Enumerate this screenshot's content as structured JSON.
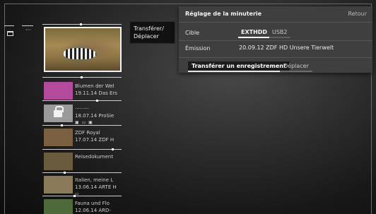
{
  "left_column": {
    "more_label": "···"
  },
  "recordings": {
    "items": [
      {
        "title": "Blumen der Wel",
        "date_channel": "19.11.14 Das Ers",
        "badges": "",
        "thumb_color": "#b44a9c",
        "locked": false
      },
      {
        "title": "·········",
        "date_channel": "18.07.14 ProSie",
        "badges": "▣ ▭ ▣",
        "thumb_color": "#9a9a9a",
        "locked": true
      },
      {
        "title": "ZDF Royal",
        "date_channel": "17.07.14 ZDF H",
        "badges": "",
        "thumb_color": "#7a6040",
        "locked": false
      },
      {
        "title": "Reisedokument",
        "date_channel": "",
        "badges": "",
        "thumb_color": "#6a5a3e",
        "locked": false
      },
      {
        "title": "Italien, meine L",
        "date_channel": "13.06.14 ARTE H",
        "badges": "▭",
        "thumb_color": "#8a7a5a",
        "locked": false
      },
      {
        "title": "Fauna und Flo",
        "date_channel": "12.06.14 ARD-",
        "badges": "",
        "thumb_color": "#4e6a3a",
        "locked": false
      }
    ]
  },
  "action_box": {
    "line1": "Transférer/",
    "line2": "Déplacer"
  },
  "panel": {
    "title": "Réglage de la minuterie",
    "back_label": "Retour",
    "target_label": "Cible",
    "target_options": [
      "EXTHDD",
      "USB2"
    ],
    "emission_label": "Émission",
    "emission_value": "20.09.12 ZDF HD Unsere Tierwelt",
    "primary_button": "Transférer un enregistrement",
    "secondary_button": "Déplacer"
  },
  "colors": {
    "panel_bg": "#3f3f3f",
    "accent": "#f4f4f4",
    "background": "#1e1e1e"
  }
}
